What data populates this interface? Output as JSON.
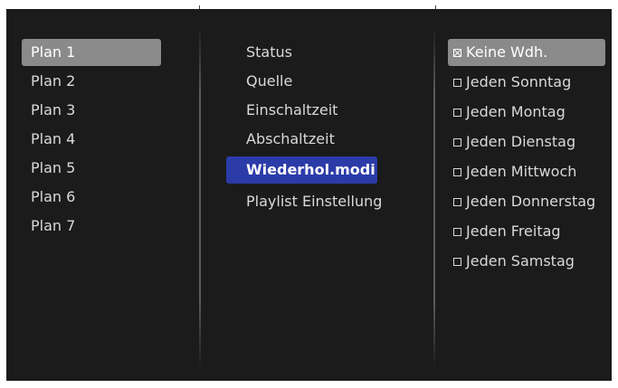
{
  "plans": {
    "items": [
      {
        "label": "Plan 1",
        "selected": true
      },
      {
        "label": "Plan 2",
        "selected": false
      },
      {
        "label": "Plan 3",
        "selected": false
      },
      {
        "label": "Plan 4",
        "selected": false
      },
      {
        "label": "Plan 5",
        "selected": false
      },
      {
        "label": "Plan 6",
        "selected": false
      },
      {
        "label": "Plan 7",
        "selected": false
      }
    ]
  },
  "settings": {
    "items": [
      {
        "label": "Status",
        "active": false
      },
      {
        "label": "Quelle",
        "active": false
      },
      {
        "label": "Einschaltzeit",
        "active": false
      },
      {
        "label": "Abschaltzeit",
        "active": false
      },
      {
        "label": "Wiederhol.modi",
        "active": true
      },
      {
        "label": "Playlist Einstellung",
        "active": false
      }
    ]
  },
  "repeat_modes": {
    "items": [
      {
        "label": "Keine Wdh.",
        "checked": true,
        "highlighted": true
      },
      {
        "label": "Jeden Sonntag",
        "checked": false,
        "highlighted": false
      },
      {
        "label": "Jeden Montag",
        "checked": false,
        "highlighted": false
      },
      {
        "label": "Jeden Dienstag",
        "checked": false,
        "highlighted": false
      },
      {
        "label": "Jeden Mittwoch",
        "checked": false,
        "highlighted": false
      },
      {
        "label": "Jeden Donnerstag",
        "checked": false,
        "highlighted": false
      },
      {
        "label": "Jeden Freitag",
        "checked": false,
        "highlighted": false
      },
      {
        "label": "Jeden Samstag",
        "checked": false,
        "highlighted": false
      }
    ]
  },
  "colors": {
    "background": "#1b1b1b",
    "selection": "#8a8a8a",
    "active": "#2b3ba8",
    "text": "#d9d9d9"
  }
}
